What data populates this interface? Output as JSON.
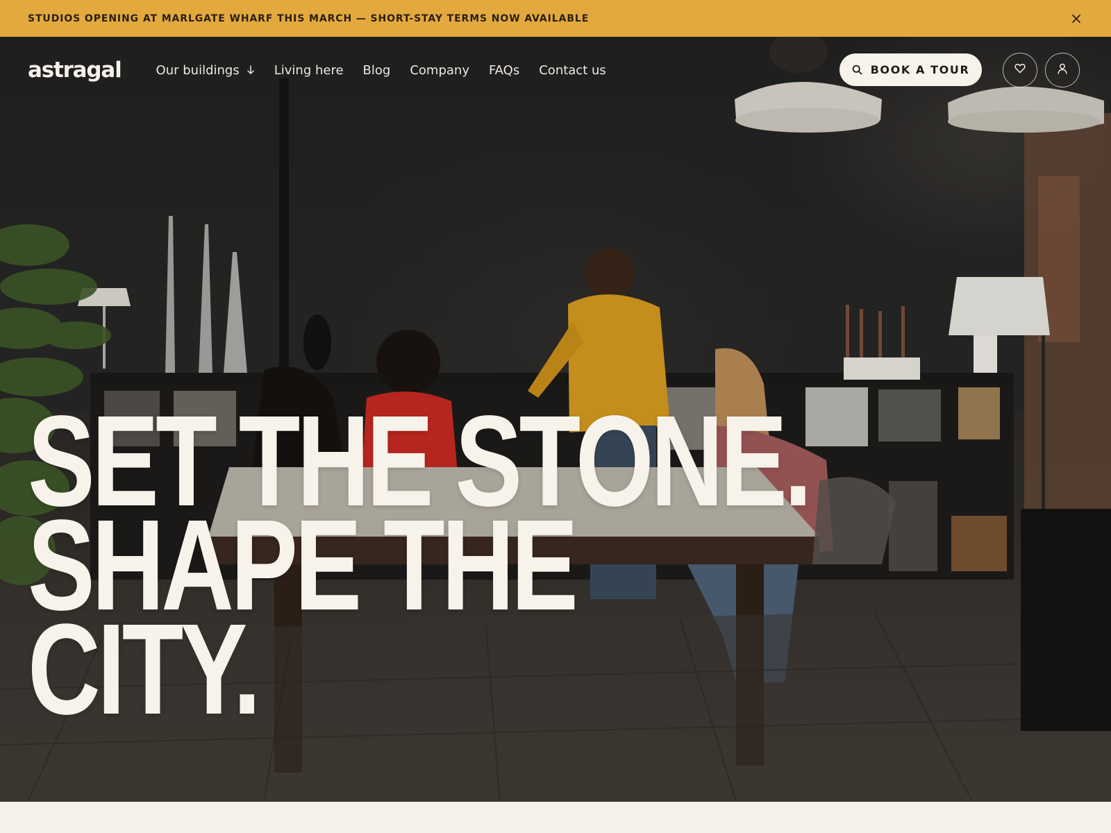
{
  "announcement": {
    "text": "STUDIOS OPENING AT MARLGATE WHARF THIS MARCH — SHORT-STAY TERMS NOW AVAILABLE",
    "close_icon": "close-icon",
    "background": "#e3a93e"
  },
  "nav": {
    "logo": "astragal",
    "links": [
      {
        "label": "Our buildings",
        "icon": "arrow-down-icon"
      },
      {
        "label": "Living here"
      },
      {
        "label": "Blog"
      },
      {
        "label": "Company"
      },
      {
        "label": "FAQs"
      },
      {
        "label": "Contact us"
      }
    ],
    "cta": {
      "label": "BOOK A TOUR",
      "icon": "search-icon"
    },
    "icon_buttons": [
      {
        "name": "favorites-button",
        "icon": "heart-icon"
      },
      {
        "name": "account-button",
        "icon": "user-icon"
      }
    ]
  },
  "hero": {
    "headline_lines": [
      "SET THE STONE.",
      "SHAPE THE",
      "CITY."
    ],
    "text_color": "#f7f3ea"
  }
}
